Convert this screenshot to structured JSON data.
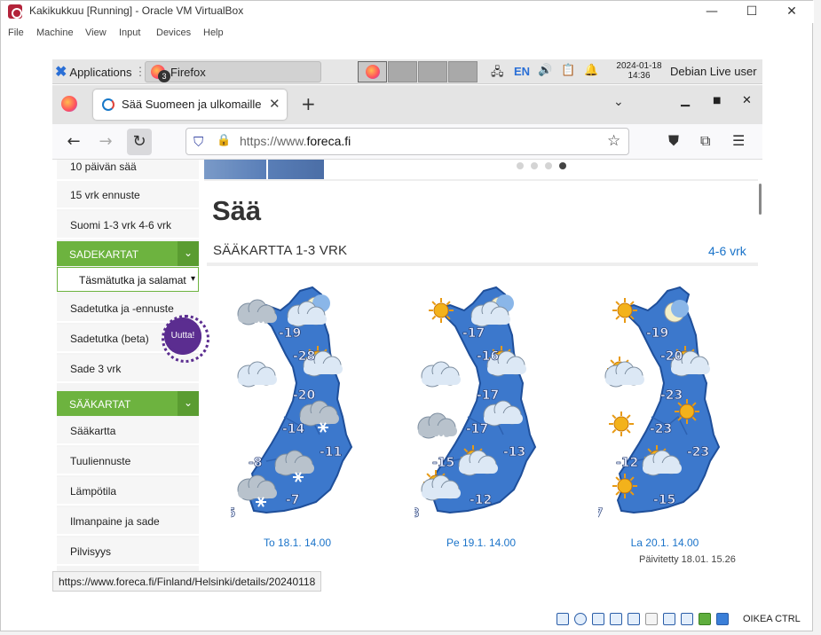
{
  "vbox": {
    "title": "Kakikukkuu [Running] - Oracle VM VirtualBox",
    "menu": [
      "File",
      "Machine",
      "View",
      "Input",
      "Devices",
      "Help"
    ],
    "window_controls": {
      "minimize": "—",
      "maximize": "☐",
      "close": "✕"
    },
    "host_key": "OIKEA CTRL"
  },
  "panel": {
    "applications": "Applications",
    "task_label": "Firefox",
    "task_count": "3",
    "lang": "EN",
    "date": "2024-01-18",
    "time": "14:36",
    "user": "Debian Live user"
  },
  "firefox": {
    "tab_title": "Sää Suomeen ja ulkomaille",
    "url_prefix": "https://www.",
    "url_domain": "foreca.fi",
    "status_url": "https://www.foreca.fi/Finland/Helsinki/details/20240118"
  },
  "sidebar": {
    "items_top": [
      "10 päivän sää",
      "15 vrk ennuste",
      "Suomi 1-3 vrk   4-6 vrk"
    ],
    "rain_head": "SADEKARTAT",
    "radar_select": "Täsmätutka ja salamat",
    "rain_items": [
      "Sadetutka ja -ennuste",
      "Sadetutka (beta)",
      "Sade 3 vrk"
    ],
    "badge": "Uutta!",
    "weather_head": "SÄÄKARTAT",
    "weather_items": [
      "Sääkartta",
      "Tuuliennuste",
      "Lämpötila",
      "Ilmanpaine ja sade",
      "Pilvisyys"
    ]
  },
  "main": {
    "page_title": "Sää",
    "section_title": "SÄÄKARTTA 1-3 VRK",
    "section_link": "4-6 vrk",
    "updated": "Päivitetty 18.01. 15.26",
    "maps": [
      {
        "date": "To 18.1. 14.00",
        "temps": [
          "-19",
          "-28",
          "-20",
          "-14",
          "-8",
          "-11",
          "-7",
          "-5"
        ]
      },
      {
        "date": "Pe 19.1. 14.00",
        "temps": [
          "-17",
          "-16",
          "-17",
          "-17",
          "-15",
          "-13",
          "-12",
          "-8"
        ]
      },
      {
        "date": "La 20.1. 14.00",
        "temps": [
          "-19",
          "-20",
          "-23",
          "-23",
          "-12",
          "-23",
          "-15",
          "-7"
        ]
      }
    ]
  }
}
